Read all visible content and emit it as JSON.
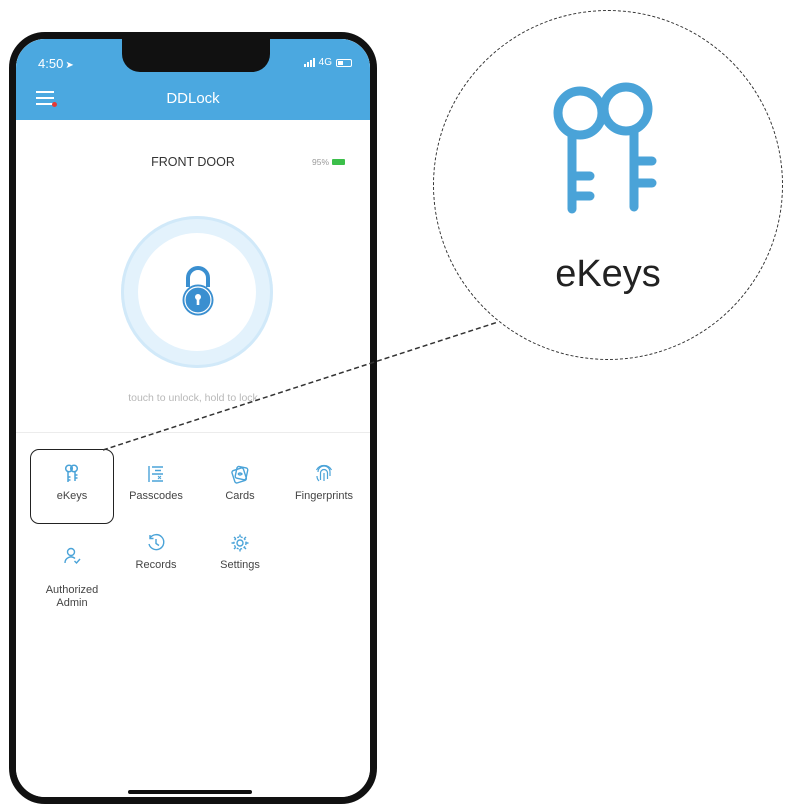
{
  "status_bar": {
    "time": "4:50",
    "network": "4G"
  },
  "app": {
    "title": "DDLock"
  },
  "lock": {
    "name": "FRONT DOOR",
    "battery": "95%",
    "battery_color": "#3cbf4a",
    "hint": "touch to unlock, hold to lock"
  },
  "menu": {
    "items": [
      {
        "label": "eKeys",
        "icon": "ekeys-icon"
      },
      {
        "label": "Passcodes",
        "icon": "passcodes-icon"
      },
      {
        "label": "Cards",
        "icon": "cards-icon"
      },
      {
        "label": "Fingerprints",
        "icon": "fingerprint-icon"
      },
      {
        "label": "Authorized\nAdmin",
        "icon": "admin-icon"
      },
      {
        "label": "Records",
        "icon": "records-icon"
      },
      {
        "label": "Settings",
        "icon": "settings-icon"
      }
    ]
  },
  "callout": {
    "label": "eKeys",
    "icon": "ekeys-icon"
  },
  "colors": {
    "accent": "#4ba8e0",
    "icon_blue": "#4aa3d8"
  }
}
